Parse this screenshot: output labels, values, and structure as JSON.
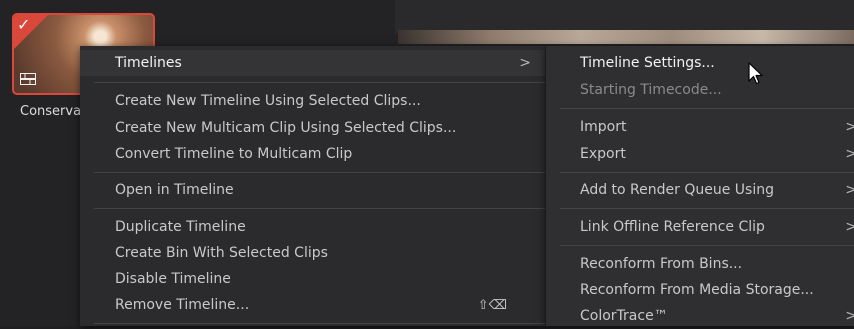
{
  "clip": {
    "name": "Conserva",
    "selected": true,
    "icons": {
      "check": "check-icon",
      "timeline": "timeline-icon"
    },
    "check_glyph": "✓",
    "accent": "#d9483b"
  },
  "menu": {
    "items": [
      {
        "label": "Timelines",
        "arrow": ">"
      },
      {
        "label": "Create New Timeline Using Selected Clips..."
      },
      {
        "label": "Create New Multicam Clip Using Selected Clips..."
      },
      {
        "label": "Convert Timeline to Multicam Clip"
      },
      {
        "label": "Open in Timeline"
      },
      {
        "label": "Duplicate Timeline"
      },
      {
        "label": "Create Bin With Selected Clips"
      },
      {
        "label": "Disable Timeline"
      },
      {
        "label": "Remove Timeline...",
        "shortcut": "⇧⌫"
      }
    ]
  },
  "submenu": {
    "items": [
      {
        "label": "Timeline Settings...",
        "arrow": ""
      },
      {
        "label": "Starting Timecode...",
        "arrow": ""
      },
      {
        "label": "Import",
        "arrow": ">"
      },
      {
        "label": "Export",
        "arrow": ">"
      },
      {
        "label": "Add to Render Queue Using",
        "arrow": ">"
      },
      {
        "label": "Link Offline Reference Clip",
        "arrow": ">"
      },
      {
        "label": "Reconform From Bins...",
        "arrow": ""
      },
      {
        "label": "Reconform From Media Storage...",
        "arrow": ""
      },
      {
        "label": "ColorTrace™",
        "arrow": ">"
      }
    ]
  },
  "cursor_icon": "pointer-cursor-icon"
}
